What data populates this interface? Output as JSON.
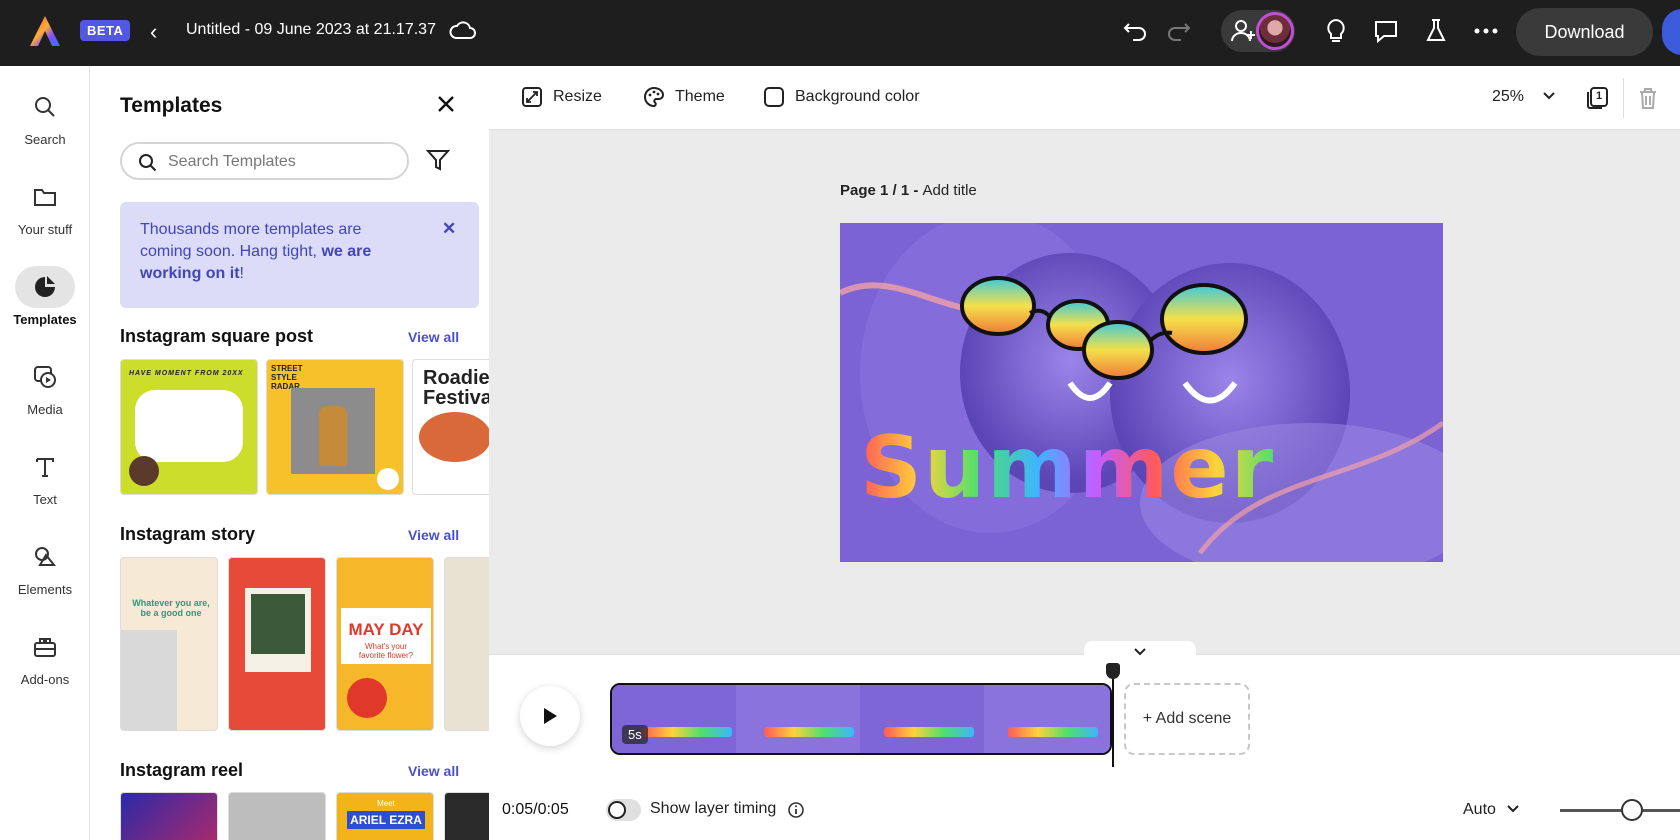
{
  "app": {
    "beta_badge": "BETA",
    "document_title": "Untitled - 09 June 2023 at 21.17.37",
    "download_label": "Download"
  },
  "rail": {
    "items": [
      {
        "label": "Search",
        "icon": "search-icon"
      },
      {
        "label": "Your stuff",
        "icon": "folder-icon"
      },
      {
        "label": "Templates",
        "icon": "templates-icon",
        "active": true
      },
      {
        "label": "Media",
        "icon": "media-icon"
      },
      {
        "label": "Text",
        "icon": "text-icon"
      },
      {
        "label": "Elements",
        "icon": "elements-icon"
      },
      {
        "label": "Add-ons",
        "icon": "addons-icon"
      }
    ]
  },
  "panel": {
    "title": "Templates",
    "search_placeholder": "Search Templates",
    "notice": {
      "text_1": "Thousands more templates are coming soon. Hang tight, ",
      "text_bold": "we are working on it",
      "text_2": "!"
    },
    "sections": [
      {
        "title": "Instagram square post",
        "view_all": "View all",
        "thumbs": [
          {
            "text": "HAVE MOMENT FROM 20XX",
            "bg": "#cddd2c"
          },
          {
            "text": "STREET STYLE RADAR",
            "bg": "#f7c12b"
          },
          {
            "text": "Roadie Festiva",
            "bg": "#ffffff"
          }
        ]
      },
      {
        "title": "Instagram story",
        "view_all": "View all",
        "thumbs": [
          {
            "text": "Whatever you are, be a good one",
            "bg": "#f6ead6"
          },
          {
            "text": "",
            "bg": "#e84a3a"
          },
          {
            "text": "MAY DAY",
            "subtext": "What's your favorite flower?",
            "bg": "#f7b72b"
          },
          {
            "text": "",
            "bg": "#e9e2d2"
          }
        ]
      },
      {
        "title": "Instagram reel",
        "view_all": "View all",
        "thumbs": [
          {
            "text": "",
            "bg": "#3a2a8a"
          },
          {
            "text": "",
            "bg": "#bdbdbd"
          },
          {
            "text": "ARIEL EZRA",
            "subtext": "Meet",
            "bg": "#f2b418"
          },
          {
            "text": "",
            "bg": "#2a2a2a"
          }
        ]
      }
    ]
  },
  "canvas_toolbar": {
    "resize": "Resize",
    "theme": "Theme",
    "background_color": "Background color",
    "zoom": "25%",
    "page_count": "1"
  },
  "canvas": {
    "page_label_bold": "Page 1 / 1 - ",
    "page_label_title": "Add title",
    "artboard_text": "Summer",
    "artboard_bg": "#7b63d4"
  },
  "timeline": {
    "clip_duration": "5s",
    "add_scene": "+ Add scene",
    "time": "0:05/0:05",
    "show_layer_timing": "Show layer timing",
    "zoom_mode": "Auto"
  }
}
